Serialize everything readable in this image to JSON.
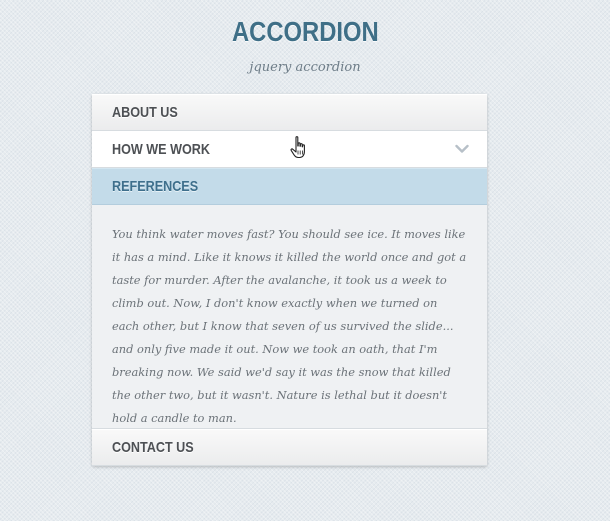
{
  "header": {
    "title": "ACCORDION",
    "subtitle": "jquery accordion"
  },
  "accordion": {
    "items": [
      {
        "label": "ABOUT US",
        "state": "collapsed"
      },
      {
        "label": "HOW WE WORK",
        "state": "hover",
        "icon": "chevron-down-icon"
      },
      {
        "label": "REFERENCES",
        "state": "expanded"
      },
      {
        "label": "CONTACT US",
        "state": "collapsed"
      }
    ],
    "open_panel_text": "You think water moves fast? You should see ice. It moves like it has a mind. Like it knows it killed the world once and got a taste for murder. After the avalanche, it took us a week to climb out. Now, I don't know exactly when we turned on each other, but I know that seven of us survived the slide... and only five made it out. Now we took an oath, that I'm breaking now. We said we'd say it was the snow that killed the other two, but it wasn't. Nature is lethal but it doesn't hold a candle to man."
  },
  "colors": {
    "title": "#3f6f87",
    "active_header": "#c3dbe9",
    "active_label": "#3e6f8c",
    "label": "#4d5054",
    "body_text": "#6b7278",
    "background": "#e6ebef"
  },
  "cursor": {
    "icon": "hand-pointer-icon"
  }
}
